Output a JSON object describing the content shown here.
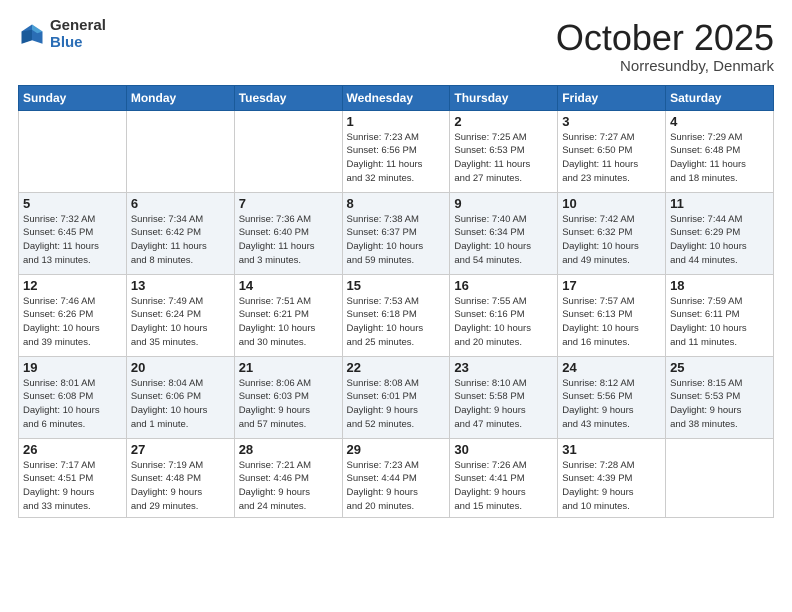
{
  "logo": {
    "general": "General",
    "blue": "Blue"
  },
  "header": {
    "month": "October 2025",
    "location": "Norresundby, Denmark"
  },
  "weekdays": [
    "Sunday",
    "Monday",
    "Tuesday",
    "Wednesday",
    "Thursday",
    "Friday",
    "Saturday"
  ],
  "weeks": [
    [
      {
        "day": "",
        "info": ""
      },
      {
        "day": "",
        "info": ""
      },
      {
        "day": "",
        "info": ""
      },
      {
        "day": "1",
        "info": "Sunrise: 7:23 AM\nSunset: 6:56 PM\nDaylight: 11 hours\nand 32 minutes."
      },
      {
        "day": "2",
        "info": "Sunrise: 7:25 AM\nSunset: 6:53 PM\nDaylight: 11 hours\nand 27 minutes."
      },
      {
        "day": "3",
        "info": "Sunrise: 7:27 AM\nSunset: 6:50 PM\nDaylight: 11 hours\nand 23 minutes."
      },
      {
        "day": "4",
        "info": "Sunrise: 7:29 AM\nSunset: 6:48 PM\nDaylight: 11 hours\nand 18 minutes."
      }
    ],
    [
      {
        "day": "5",
        "info": "Sunrise: 7:32 AM\nSunset: 6:45 PM\nDaylight: 11 hours\nand 13 minutes."
      },
      {
        "day": "6",
        "info": "Sunrise: 7:34 AM\nSunset: 6:42 PM\nDaylight: 11 hours\nand 8 minutes."
      },
      {
        "day": "7",
        "info": "Sunrise: 7:36 AM\nSunset: 6:40 PM\nDaylight: 11 hours\nand 3 minutes."
      },
      {
        "day": "8",
        "info": "Sunrise: 7:38 AM\nSunset: 6:37 PM\nDaylight: 10 hours\nand 59 minutes."
      },
      {
        "day": "9",
        "info": "Sunrise: 7:40 AM\nSunset: 6:34 PM\nDaylight: 10 hours\nand 54 minutes."
      },
      {
        "day": "10",
        "info": "Sunrise: 7:42 AM\nSunset: 6:32 PM\nDaylight: 10 hours\nand 49 minutes."
      },
      {
        "day": "11",
        "info": "Sunrise: 7:44 AM\nSunset: 6:29 PM\nDaylight: 10 hours\nand 44 minutes."
      }
    ],
    [
      {
        "day": "12",
        "info": "Sunrise: 7:46 AM\nSunset: 6:26 PM\nDaylight: 10 hours\nand 39 minutes."
      },
      {
        "day": "13",
        "info": "Sunrise: 7:49 AM\nSunset: 6:24 PM\nDaylight: 10 hours\nand 35 minutes."
      },
      {
        "day": "14",
        "info": "Sunrise: 7:51 AM\nSunset: 6:21 PM\nDaylight: 10 hours\nand 30 minutes."
      },
      {
        "day": "15",
        "info": "Sunrise: 7:53 AM\nSunset: 6:18 PM\nDaylight: 10 hours\nand 25 minutes."
      },
      {
        "day": "16",
        "info": "Sunrise: 7:55 AM\nSunset: 6:16 PM\nDaylight: 10 hours\nand 20 minutes."
      },
      {
        "day": "17",
        "info": "Sunrise: 7:57 AM\nSunset: 6:13 PM\nDaylight: 10 hours\nand 16 minutes."
      },
      {
        "day": "18",
        "info": "Sunrise: 7:59 AM\nSunset: 6:11 PM\nDaylight: 10 hours\nand 11 minutes."
      }
    ],
    [
      {
        "day": "19",
        "info": "Sunrise: 8:01 AM\nSunset: 6:08 PM\nDaylight: 10 hours\nand 6 minutes."
      },
      {
        "day": "20",
        "info": "Sunrise: 8:04 AM\nSunset: 6:06 PM\nDaylight: 10 hours\nand 1 minute."
      },
      {
        "day": "21",
        "info": "Sunrise: 8:06 AM\nSunset: 6:03 PM\nDaylight: 9 hours\nand 57 minutes."
      },
      {
        "day": "22",
        "info": "Sunrise: 8:08 AM\nSunset: 6:01 PM\nDaylight: 9 hours\nand 52 minutes."
      },
      {
        "day": "23",
        "info": "Sunrise: 8:10 AM\nSunset: 5:58 PM\nDaylight: 9 hours\nand 47 minutes."
      },
      {
        "day": "24",
        "info": "Sunrise: 8:12 AM\nSunset: 5:56 PM\nDaylight: 9 hours\nand 43 minutes."
      },
      {
        "day": "25",
        "info": "Sunrise: 8:15 AM\nSunset: 5:53 PM\nDaylight: 9 hours\nand 38 minutes."
      }
    ],
    [
      {
        "day": "26",
        "info": "Sunrise: 7:17 AM\nSunset: 4:51 PM\nDaylight: 9 hours\nand 33 minutes."
      },
      {
        "day": "27",
        "info": "Sunrise: 7:19 AM\nSunset: 4:48 PM\nDaylight: 9 hours\nand 29 minutes."
      },
      {
        "day": "28",
        "info": "Sunrise: 7:21 AM\nSunset: 4:46 PM\nDaylight: 9 hours\nand 24 minutes."
      },
      {
        "day": "29",
        "info": "Sunrise: 7:23 AM\nSunset: 4:44 PM\nDaylight: 9 hours\nand 20 minutes."
      },
      {
        "day": "30",
        "info": "Sunrise: 7:26 AM\nSunset: 4:41 PM\nDaylight: 9 hours\nand 15 minutes."
      },
      {
        "day": "31",
        "info": "Sunrise: 7:28 AM\nSunset: 4:39 PM\nDaylight: 9 hours\nand 10 minutes."
      },
      {
        "day": "",
        "info": ""
      }
    ]
  ]
}
